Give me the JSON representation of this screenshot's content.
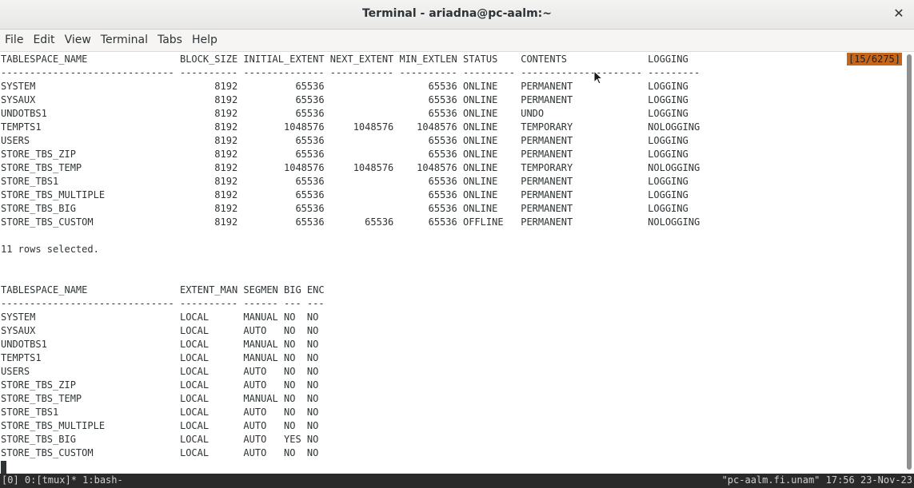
{
  "window": {
    "title": "Terminal - ariadna@pc-aalm:~",
    "close_glyph": "✕"
  },
  "menu": [
    "File",
    "Edit",
    "View",
    "Terminal",
    "Tabs",
    "Help"
  ],
  "terminal": {
    "counter": "[15/6275]",
    "lines": [
      "TABLESPACE_NAME                BLOCK_SIZE INITIAL_EXTENT NEXT_EXTENT MIN_EXTLEN STATUS    CONTENTS              LOGGING",
      "------------------------------ ---------- -------------- ----------- ---------- --------- --------------------- ---------",
      "SYSTEM                               8192          65536                  65536 ONLINE    PERMANENT             LOGGING",
      "SYSAUX                               8192          65536                  65536 ONLINE    PERMANENT             LOGGING",
      "UNDOTBS1                             8192          65536                  65536 ONLINE    UNDO                  LOGGING",
      "TEMPTS1                              8192        1048576     1048576    1048576 ONLINE    TEMPORARY             NOLOGGING",
      "USERS                                8192          65536                  65536 ONLINE    PERMANENT             LOGGING",
      "STORE_TBS_ZIP                        8192          65536                  65536 ONLINE    PERMANENT             LOGGING",
      "STORE_TBS_TEMP                       8192        1048576     1048576    1048576 ONLINE    TEMPORARY             NOLOGGING",
      "STORE_TBS1                           8192          65536                  65536 ONLINE    PERMANENT             LOGGING",
      "STORE_TBS_MULTIPLE                   8192          65536                  65536 ONLINE    PERMANENT             LOGGING",
      "STORE_TBS_BIG                        8192          65536                  65536 ONLINE    PERMANENT             LOGGING",
      "STORE_TBS_CUSTOM                     8192          65536       65536      65536 OFFLINE   PERMANENT             NOLOGGING",
      "",
      "11 rows selected.",
      "",
      "",
      "TABLESPACE_NAME                EXTENT_MAN SEGMEN BIG ENC",
      "------------------------------ ---------- ------ --- ---",
      "SYSTEM                         LOCAL      MANUAL NO  NO",
      "SYSAUX                         LOCAL      AUTO   NO  NO",
      "UNDOTBS1                       LOCAL      MANUAL NO  NO",
      "TEMPTS1                        LOCAL      MANUAL NO  NO",
      "USERS                          LOCAL      AUTO   NO  NO",
      "STORE_TBS_ZIP                  LOCAL      AUTO   NO  NO",
      "STORE_TBS_TEMP                 LOCAL      MANUAL NO  NO",
      "STORE_TBS1                     LOCAL      AUTO   NO  NO",
      "STORE_TBS_MULTIPLE             LOCAL      AUTO   NO  NO",
      "STORE_TBS_BIG                  LOCAL      AUTO   YES NO",
      "STORE_TBS_CUSTOM               LOCAL      AUTO   NO  NO"
    ]
  },
  "statusbar": {
    "left": "[0] 0:[tmux]* 1:bash-",
    "right": "\"pc-aalm.fi.unam\" 17:56 23-Nov-23"
  },
  "colors": {
    "counter_bg": "#c4671c",
    "statusbar_bg": "#2a2a2a"
  }
}
